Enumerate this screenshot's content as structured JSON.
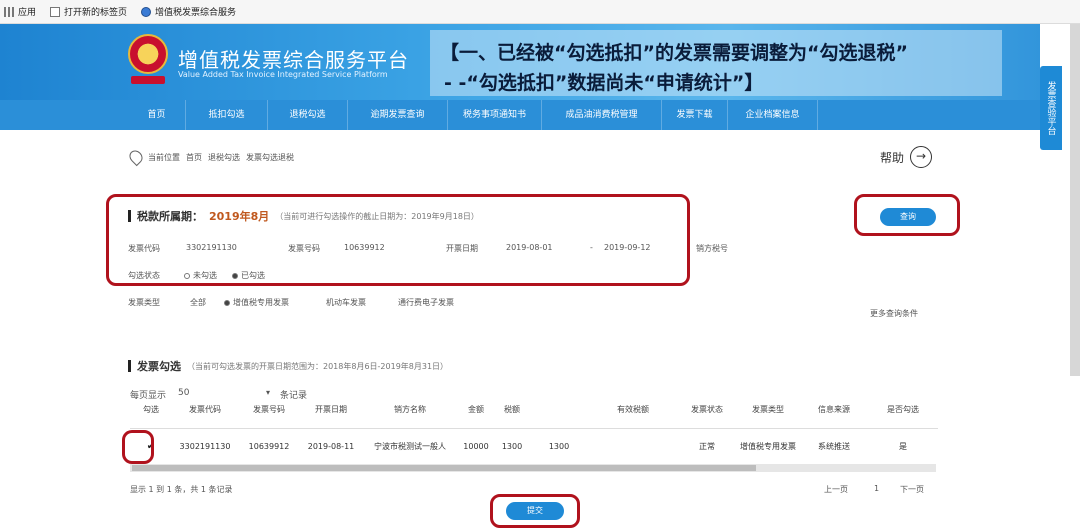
{
  "bookmarks": [
    {
      "label": "应用",
      "icon": "apps-icon"
    },
    {
      "label": "打开新的标签页",
      "icon": "page-icon"
    },
    {
      "label": "增值税发票综合服务",
      "icon": "globe-icon"
    }
  ],
  "header": {
    "title": "增值税发票综合服务平台",
    "subtitle": "Value Added Tax Invoice Integrated Service Platform",
    "notice_line1": "【一、已经被“勾选抵扣”的发票需要调整为“勾选退税”",
    "notice_line2": "- -“勾选抵扣”数据尚未“申请统计”】"
  },
  "nav": [
    "首页",
    "抵扣勾选",
    "退税勾选",
    "逾期发票查询",
    "税务事项通知书",
    "成品油消费税管理",
    "发票下载",
    "企业档案信息"
  ],
  "side_tab": "发票查验平台",
  "breadcrumb": {
    "prefix": "当前位置",
    "home": "首页",
    "path1": "退税勾选",
    "path2": "发票勾选退税"
  },
  "help_label": "帮助",
  "query": {
    "period_label": "税款所属期：",
    "period_value": "2019年8月",
    "period_note": "（当前可进行勾选操作的截止日期为：2019年9月18日）",
    "code_label": "发票代码",
    "code_value": "3302191130",
    "number_label": "发票号码",
    "number_value": "10639912",
    "date_label": "开票日期",
    "date_from": "2019-08-01",
    "date_sep": "-",
    "date_to": "2019-09-12",
    "seller_tax_label": "销方税号",
    "status_label": "勾选状态",
    "status_options": [
      "未勾选",
      "已勾选"
    ],
    "status_selected": 1,
    "query_button": "查询",
    "type_label": "发票类型",
    "type_options": [
      "全部",
      "增值税专用发票",
      "机动车发票",
      "通行费电子发票"
    ],
    "type_selected": 1,
    "more_label": "更多查询条件"
  },
  "selection": {
    "title": "发票勾选",
    "note": "（当前可勾选发票的开票日期范围为：2018年8月6日-2019年8月31日）",
    "per_page_label": "每页显示",
    "per_page_value": "50",
    "per_page_suffix": "条记录",
    "columns": [
      "勾选",
      "发票代码",
      "发票号码",
      "开票日期",
      "销方名称",
      "金额",
      "税额",
      "",
      "有效税额",
      "发票状态",
      "发票类型",
      "信息来源",
      "是否勾选"
    ],
    "rows": [
      {
        "check": "✔",
        "code": "3302191130",
        "number": "10639912",
        "date": "2019-08-11",
        "seller": "宁波市税测试一般人",
        "amount": "10000",
        "tax": "1300",
        "extra": "1300",
        "valid_tax": "",
        "status": "正常",
        "type": "增值税专用发票",
        "source": "系统推送",
        "checked": "是"
      }
    ],
    "footer_info": "显示 1 到 1 条，共 1 条记录",
    "pager_prev": "上一页",
    "pager_page": "1",
    "pager_next": "下一页",
    "submit_button": "提交"
  }
}
